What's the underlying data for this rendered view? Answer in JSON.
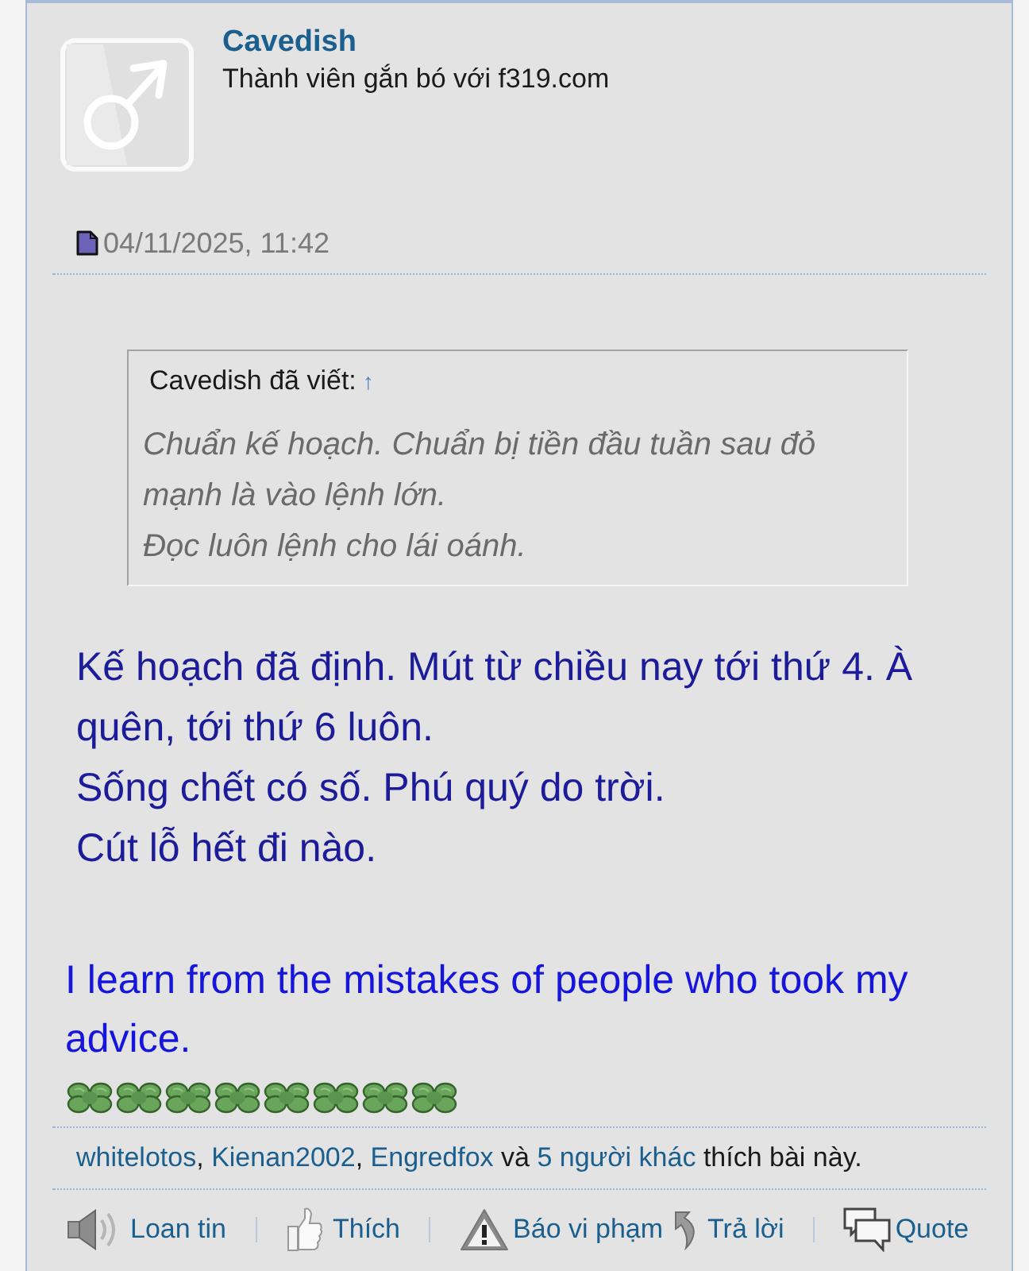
{
  "post": {
    "author": {
      "name": "Cavedish",
      "rank": "Thành viên gắn bó với f319.com"
    },
    "date": "04/11/2025, 11:42",
    "quote": {
      "attribution": "Cavedish đã viết:",
      "jump_link": "↑",
      "lines": [
        "Chuẩn kế hoạch. Chuẩn bị tiền đầu tuần sau đỏ mạnh là vào lệnh lớn.",
        "Đọc luôn lệnh cho lái oánh."
      ]
    },
    "message": [
      "Kế hoạch đã định. Mút từ chiều nay tới thứ 4. À quên, tới thứ 6 luôn.",
      "Sống chết có số. Phú quý do trời.",
      "Cút lỗ hết đi nào."
    ],
    "signature": {
      "text": "I learn from the mistakes of people who took my advice.",
      "emoticons": [
        {
          "kind": "clover"
        },
        {
          "kind": "clover"
        },
        {
          "kind": "clover"
        },
        {
          "kind": "clover"
        },
        {
          "kind": "clover"
        },
        {
          "kind": "clover"
        },
        {
          "kind": "clover"
        },
        {
          "kind": "clover"
        }
      ]
    },
    "likes": [
      {
        "link": "whitelotos",
        "after": ", "
      },
      {
        "link": "Kienan2002",
        "after": ", "
      },
      {
        "link": "Engredfox",
        "after": " và "
      },
      {
        "link": "5 người khác",
        "after": " thích bài này."
      }
    ],
    "actions": [
      {
        "kind": "share",
        "label": "Loan tin",
        "divider_after": true
      },
      {
        "kind": "like",
        "label": "Thích",
        "divider_after": true
      },
      {
        "kind": "report",
        "label": "Báo vi phạm",
        "divider_after": false
      },
      {
        "kind": "reply",
        "label": "Trả lời",
        "divider_after": true
      },
      {
        "kind": "quote",
        "label": "Quote",
        "divider_after": false
      }
    ]
  }
}
